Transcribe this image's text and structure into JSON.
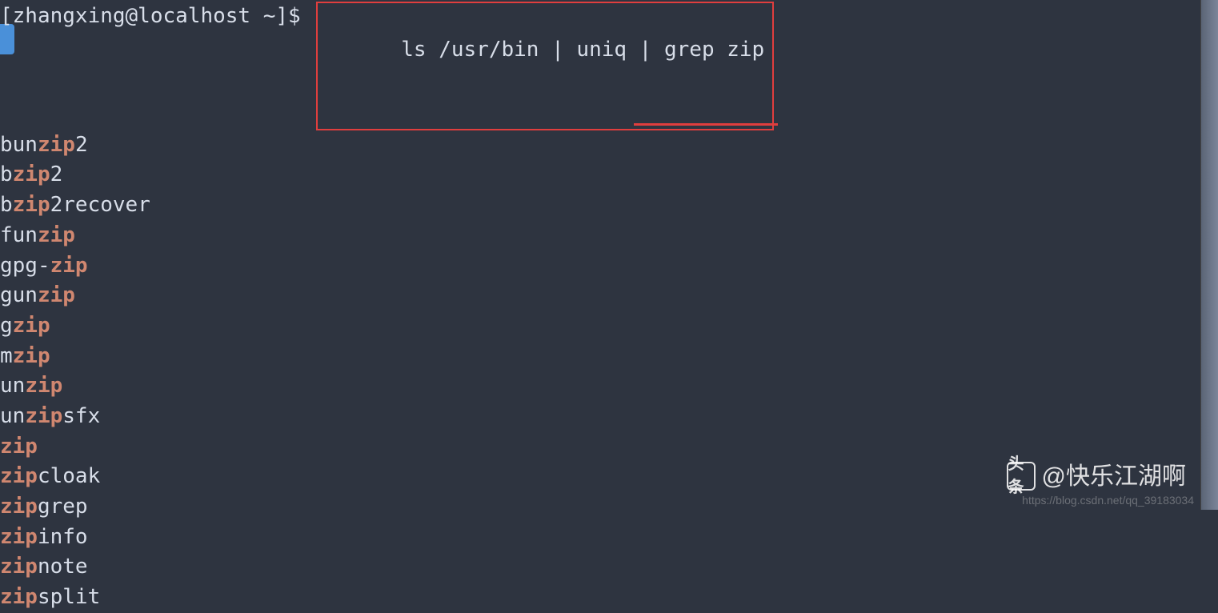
{
  "prompt": "[zhangxing@localhost ~]$ ",
  "command": "ls /usr/bin | uniq | grep zip",
  "highlight_pattern": "zip",
  "output": [
    {
      "pre": "bun",
      "match": "zip",
      "post": "2"
    },
    {
      "pre": "b",
      "match": "zip",
      "post": "2"
    },
    {
      "pre": "b",
      "match": "zip",
      "post": "2recover"
    },
    {
      "pre": "fun",
      "match": "zip",
      "post": ""
    },
    {
      "pre": "gpg-",
      "match": "zip",
      "post": ""
    },
    {
      "pre": "gun",
      "match": "zip",
      "post": ""
    },
    {
      "pre": "g",
      "match": "zip",
      "post": ""
    },
    {
      "pre": "m",
      "match": "zip",
      "post": ""
    },
    {
      "pre": "un",
      "match": "zip",
      "post": ""
    },
    {
      "pre": "un",
      "match": "zip",
      "post": "sfx"
    },
    {
      "pre": "",
      "match": "zip",
      "post": ""
    },
    {
      "pre": "",
      "match": "zip",
      "post": "cloak"
    },
    {
      "pre": "",
      "match": "zip",
      "post": "grep"
    },
    {
      "pre": "",
      "match": "zip",
      "post": "info"
    },
    {
      "pre": "",
      "match": "zip",
      "post": "note"
    },
    {
      "pre": "",
      "match": "zip",
      "post": "split"
    }
  ],
  "watermark": {
    "icon_text": "头条",
    "text": "@快乐江湖啊",
    "url": "https://blog.csdn.net/qq_39183034"
  }
}
